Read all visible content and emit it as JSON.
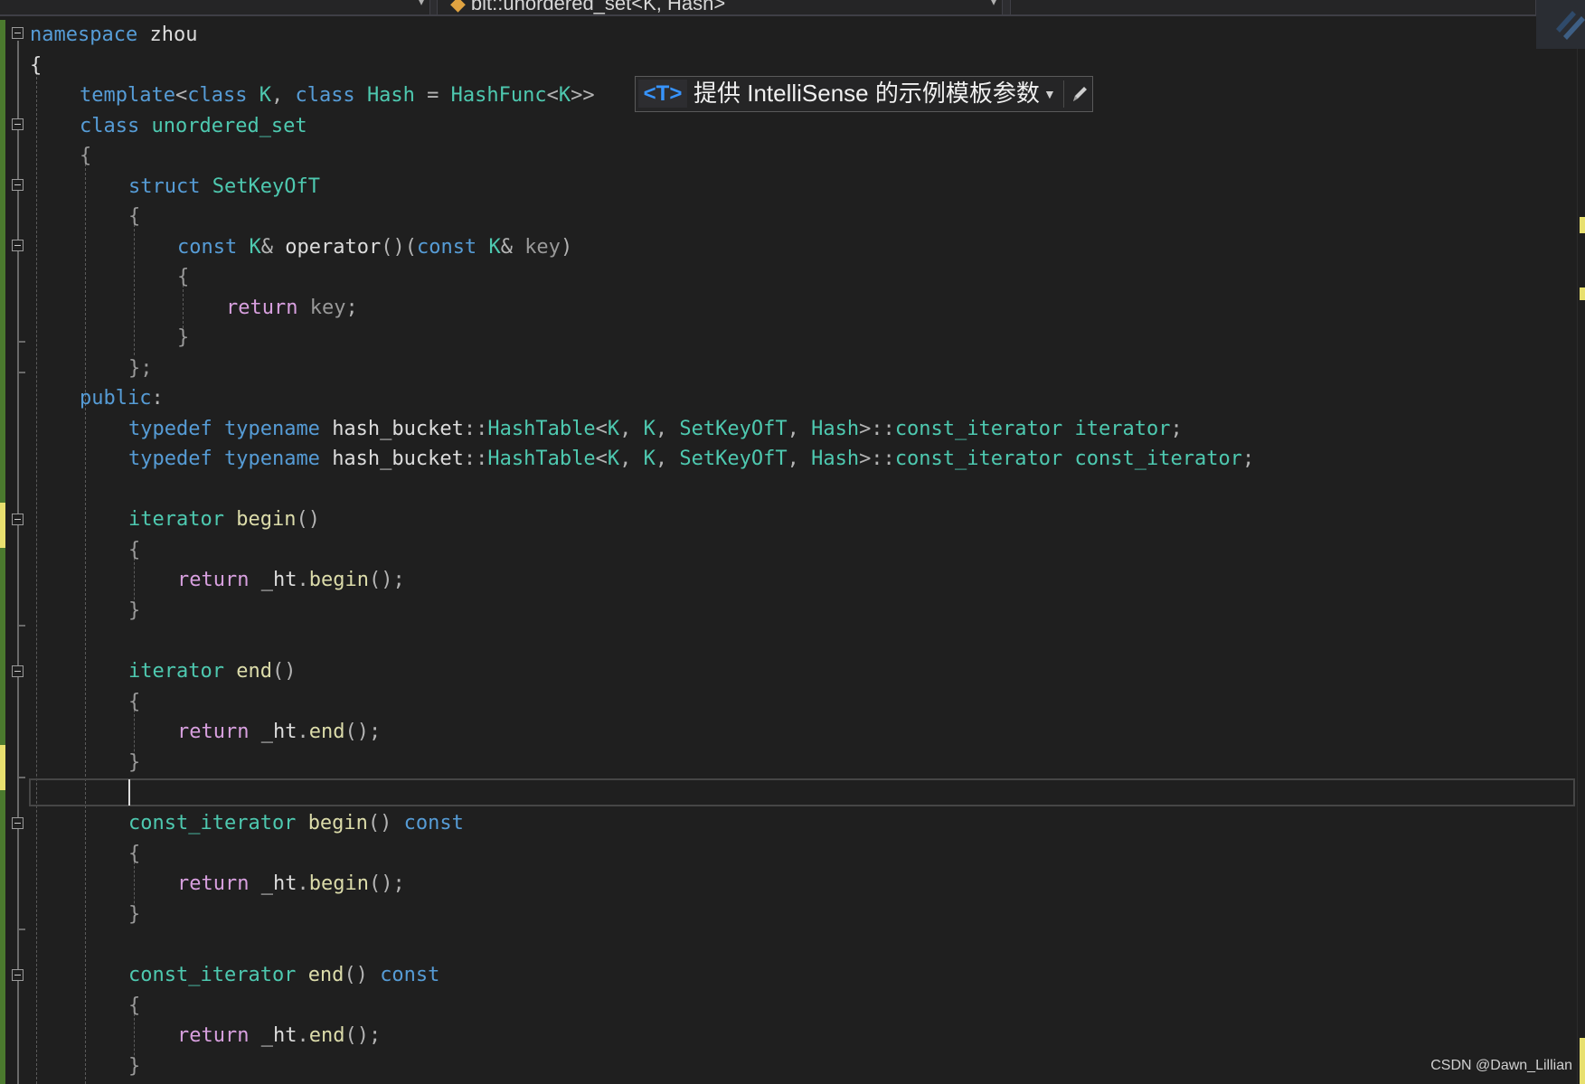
{
  "nav": {
    "scope_dropdown": "",
    "member_dropdown": "bit::unordered_set<K, Hash>",
    "right_dropdown": ""
  },
  "hint": {
    "tag": "<T>",
    "label": "提供 IntelliSense 的示例模板参数"
  },
  "code": {
    "lines": {
      "l01": "namespace zhou",
      "l02": "{",
      "l03": "template<class K, class Hash = HashFunc<K>>",
      "l04": "class unordered_set",
      "l05": "{",
      "l06": "struct SetKeyOfT",
      "l07": "{",
      "l08": "const K& operator()(const K& key)",
      "l09": "{",
      "l10": "return key;",
      "l11": "}",
      "l12": "};",
      "l13": "public:",
      "l14": "typedef typename hash_bucket::HashTable<K, K, SetKeyOfT, Hash>::const_iterator iterator;",
      "l15": "typedef typename hash_bucket::HashTable<K, K, SetKeyOfT, Hash>::const_iterator const_iterator;",
      "l17": "iterator begin()",
      "l18": "{",
      "l19": "return _ht.begin();",
      "l20": "}",
      "l22": "iterator end()",
      "l23": "{",
      "l24": "return _ht.end();",
      "l25": "}",
      "l27": "const_iterator begin() const",
      "l28": "{",
      "l29": "return _ht.begin();",
      "l30": "}",
      "l32": "const_iterator end() const",
      "l33": "{",
      "l34": "return _ht.end();",
      "l35": "}"
    }
  },
  "watermark": "CSDN @Dawn_Lillian",
  "colors": {
    "background": "#1f1f1f",
    "keyword": "#569cd6",
    "type": "#4ec9b0",
    "control": "#d8a0df",
    "function": "#dcdcaa",
    "parameter": "#9a9a9a",
    "text": "#dcdcdc",
    "change_saved": "#4b7a2e",
    "change_unsaved": "#e8e06f"
  }
}
